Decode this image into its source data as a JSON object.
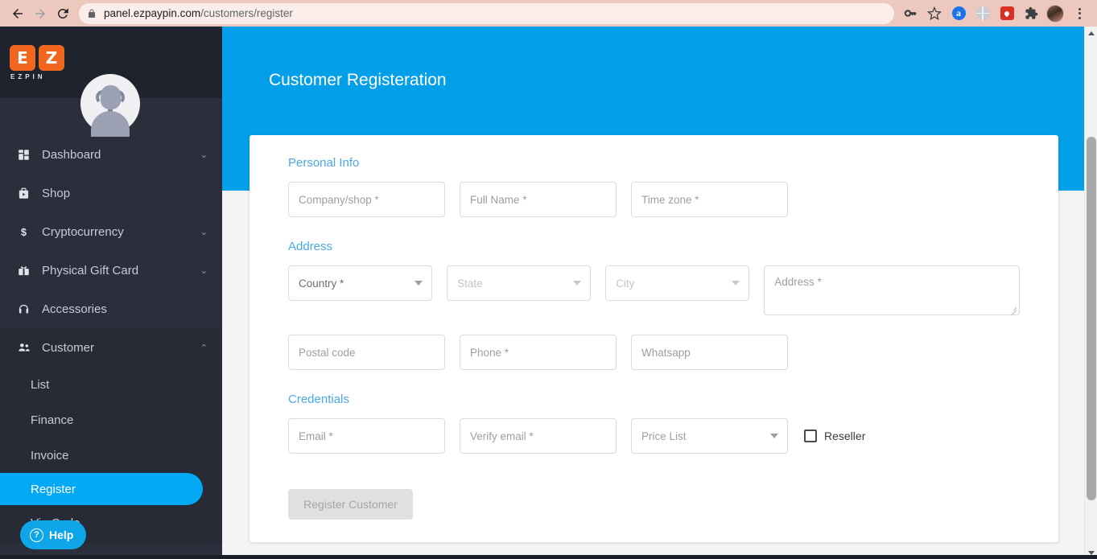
{
  "browser": {
    "back_icon": "back-arrow-icon",
    "forward_icon": "forward-arrow-icon",
    "reload_icon": "reload-icon",
    "lock_icon": "lock-icon",
    "url_domain": "panel.ezpaypin.com",
    "url_path": "/customers/register",
    "url_full": "panel.ezpaypin.com/customers/register",
    "toolbar_icons": [
      {
        "name": "password-key-icon",
        "label": ""
      },
      {
        "name": "bookmark-star-icon",
        "label": ""
      },
      {
        "name": "extension-a-icon",
        "label": "a"
      },
      {
        "name": "extension-globe-icon",
        "label": ""
      },
      {
        "name": "extension-pin-icon",
        "label": ""
      },
      {
        "name": "extensions-puzzle-icon",
        "label": ""
      },
      {
        "name": "profile-avatar-icon",
        "label": ""
      },
      {
        "name": "chrome-menu-icon",
        "label": ""
      }
    ]
  },
  "sidebar": {
    "logo": {
      "letters": [
        "E",
        "Z"
      ],
      "wordmark": "EZPIN"
    },
    "avatar": "user-avatar-placeholder",
    "items": [
      {
        "label": "Dashboard",
        "icon": "dashboard-grid-icon",
        "chevron": "⌄",
        "expandable": true
      },
      {
        "label": "Shop",
        "icon": "shop-bag-icon",
        "chevron": "",
        "expandable": false
      },
      {
        "label": "Cryptocurrency",
        "icon": "dollar-sign-icon",
        "chevron": "⌄",
        "expandable": true
      },
      {
        "label": "Physical Gift Card",
        "icon": "gift-card-icon",
        "chevron": "⌄",
        "expandable": true
      },
      {
        "label": "Accessories",
        "icon": "headphones-icon",
        "chevron": "",
        "expandable": false
      },
      {
        "label": "Customer",
        "icon": "customers-people-icon",
        "chevron": "⌃",
        "expandable": true
      }
    ],
    "submenu": [
      {
        "label": "List",
        "active": false
      },
      {
        "label": "Finance",
        "active": false
      },
      {
        "label": "Invoice",
        "active": false
      },
      {
        "label": "Register",
        "active": true
      },
      {
        "label": "Via Code",
        "active": false
      }
    ],
    "help": {
      "label": "Help",
      "icon": "question-mark-icon",
      "glyph": "?"
    }
  },
  "page": {
    "title": "Customer Registeration"
  },
  "form": {
    "sections": [
      {
        "id": "personal",
        "title": "Personal Info"
      },
      {
        "id": "address",
        "title": "Address"
      },
      {
        "id": "creds",
        "title": "Credentials"
      }
    ],
    "personal": {
      "company": {
        "placeholder": "Company/shop *",
        "value": ""
      },
      "full_name": {
        "placeholder": "Full Name *",
        "value": ""
      },
      "time_zone": {
        "placeholder": "Time zone *",
        "value": ""
      }
    },
    "address": {
      "country": {
        "placeholder": "Country *",
        "value": "",
        "selected": ""
      },
      "state": {
        "placeholder": "State",
        "value": "",
        "selected": ""
      },
      "city": {
        "placeholder": "City",
        "value": "",
        "selected": ""
      },
      "address": {
        "placeholder": "Address *",
        "value": ""
      },
      "postal_code": {
        "placeholder": "Postal code",
        "value": ""
      },
      "phone": {
        "placeholder": "Phone *",
        "value": ""
      },
      "whatsapp": {
        "placeholder": "Whatsapp",
        "value": ""
      }
    },
    "credentials": {
      "email": {
        "placeholder": "Email *",
        "value": ""
      },
      "verify_email": {
        "placeholder": "Verify email *",
        "value": ""
      },
      "price_list": {
        "placeholder": "Price List",
        "value": "",
        "selected": ""
      },
      "reseller": {
        "label": "Reseller",
        "checked": false
      }
    },
    "submit": {
      "label": "Register Customer",
      "enabled": false
    }
  },
  "colors": {
    "accent_blue": "#03a0e9",
    "sidebar_bg": "#2a2f3b",
    "sidebar_logo_bg": "#1f232d",
    "logo_orange": "#f2671f",
    "browser_bar": "#edc8bf",
    "section_heading": "#4aa8e8",
    "disabled_button": "#e0e0e0"
  },
  "scrollbar": {
    "position_pct": 22
  }
}
